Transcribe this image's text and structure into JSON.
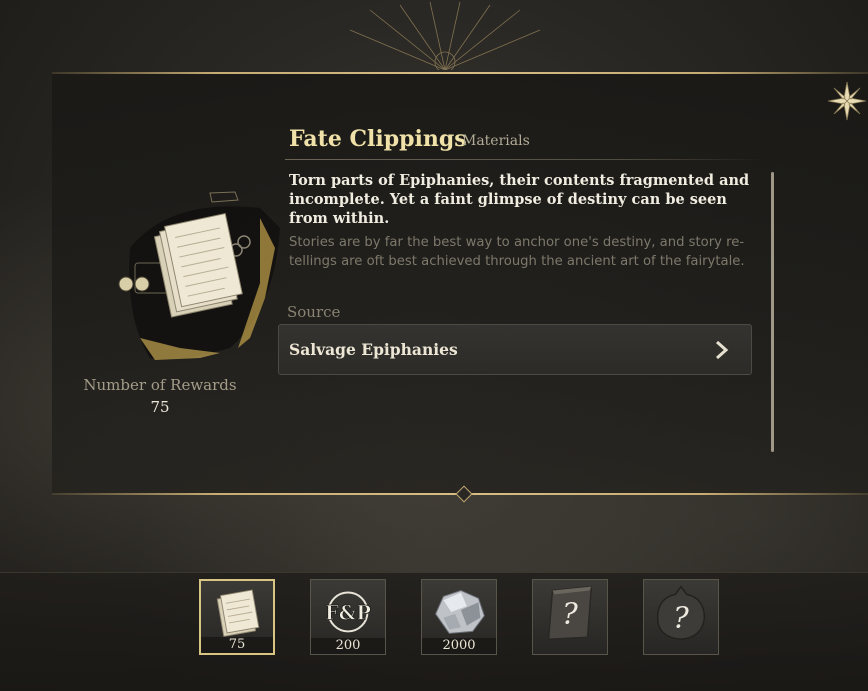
{
  "item": {
    "title": "Fate Clippings",
    "category": "Materials",
    "description": "Torn parts of Epiphanies, their contents fragmented and incomplete. Yet a faint glimpse of destiny can be seen from within.",
    "flavor": "Stories are by far the best way to anchor one's destiny, and story re-tellings are oft best achieved through the ancient art of the fairytale.",
    "rewards_label": "Number of Rewards",
    "rewards_value": "75"
  },
  "source": {
    "label": "Source",
    "button_label": "Salvage Epiphanies"
  },
  "slots": [
    {
      "icon": "paper-clippings-icon",
      "count": "75",
      "selected": true
    },
    {
      "icon": "fp-emblem-icon",
      "count": "200",
      "selected": false
    },
    {
      "icon": "silver-ore-icon",
      "count": "2000",
      "selected": false
    },
    {
      "icon": "unknown-book-icon",
      "count": "",
      "selected": false
    },
    {
      "icon": "unknown-orb-icon",
      "count": "",
      "selected": false
    }
  ],
  "slot_overlays": {
    "fp_text": "F&P",
    "unknown_mark": "?"
  },
  "colors": {
    "title_gold": "#efe1a8",
    "panel_line": "#c7ad74",
    "selected_border": "#d9c583"
  }
}
